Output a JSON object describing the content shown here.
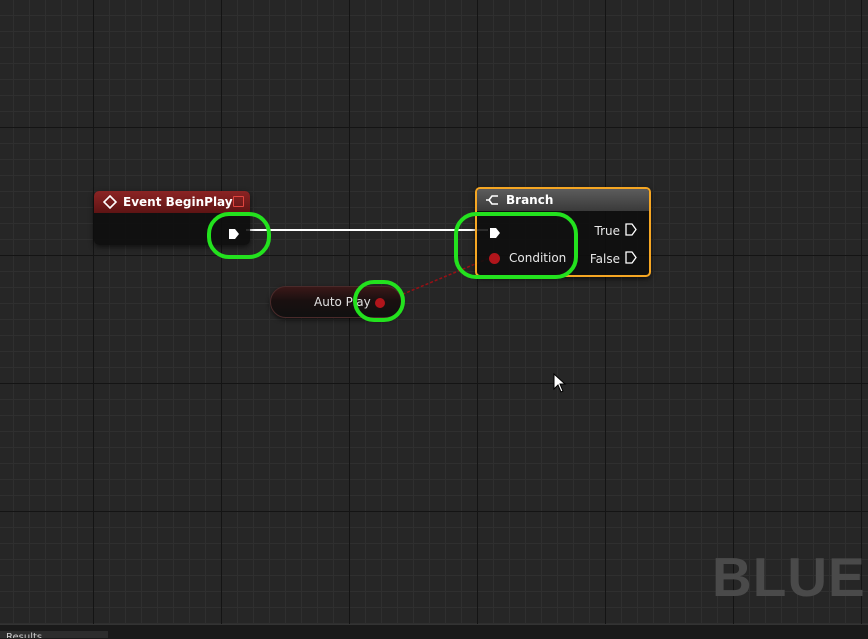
{
  "graph": {
    "watermark": "BLUEP"
  },
  "event_node": {
    "title": "Event BeginPlay",
    "icon": "event-diamond-icon",
    "header_color": "#7a1d1d"
  },
  "branch_node": {
    "title": "Branch",
    "icon": "branch-icon",
    "selected_color": "#f5a623",
    "true_label": "True",
    "false_label": "False",
    "condition_label": "Condition"
  },
  "variable_node": {
    "label": "Auto Play",
    "pin_color": "#b0151b"
  },
  "highlight_color": "#23e21e",
  "bottom_tab": {
    "label": "Results"
  }
}
